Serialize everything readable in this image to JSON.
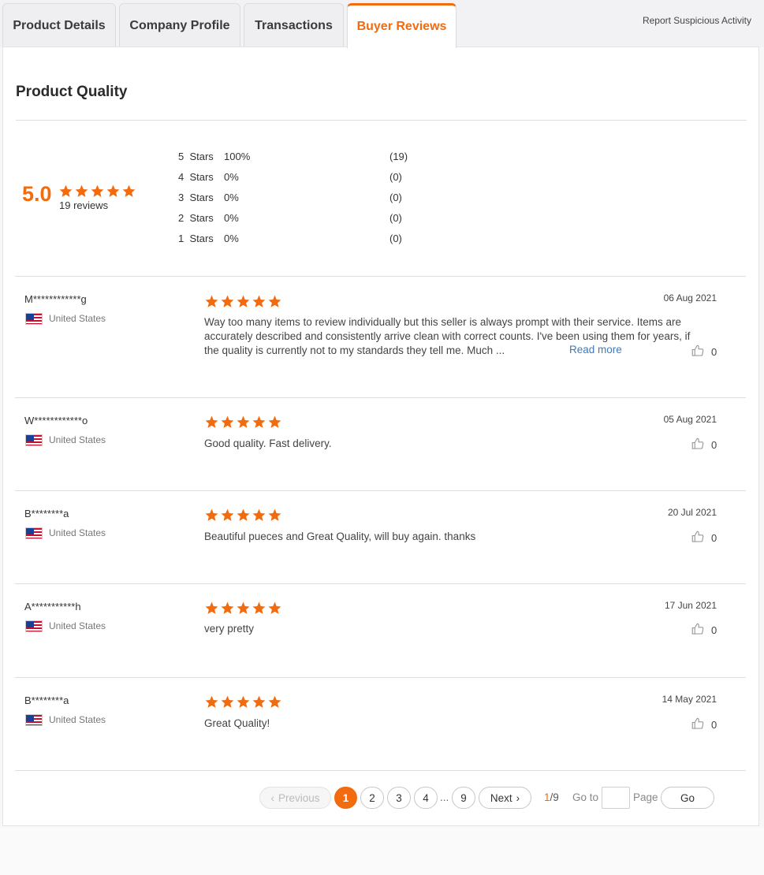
{
  "tabs": [
    {
      "label": "Product Details"
    },
    {
      "label": "Company Profile"
    },
    {
      "label": "Transactions"
    },
    {
      "label": "Buyer Reviews",
      "active": true
    }
  ],
  "report_link": "Report Suspicious Activity",
  "section_title": "Product Quality",
  "summary": {
    "score": "5.0",
    "stars": 5,
    "reviews_label": "19 reviews",
    "distribution": [
      {
        "label": "5  Stars",
        "percent": "100%",
        "count": "(19)"
      },
      {
        "label": "4  Stars",
        "percent": "0%",
        "count": "(0)"
      },
      {
        "label": "3  Stars",
        "percent": "0%",
        "count": "(0)"
      },
      {
        "label": "2  Stars",
        "percent": "0%",
        "count": "(0)"
      },
      {
        "label": "1  Stars",
        "percent": "0%",
        "count": "(0)"
      }
    ]
  },
  "reviews": [
    {
      "name": "M************g",
      "country": "United States",
      "date": "06 Aug 2021",
      "rating": 5,
      "text": "Way too many items to review individually but this seller is always prompt with their service. Items are accurately described and consistently arrive clean with correct counts. I've been using them for years, if the quality is currently not to my standards they tell me. Much ...",
      "read_more": "Read more",
      "likes": "0"
    },
    {
      "name": "W************o",
      "country": "United States",
      "date": "05 Aug 2021",
      "rating": 5,
      "text": "Good quality. Fast delivery.",
      "likes": "0"
    },
    {
      "name": "B********a",
      "country": "United States",
      "date": "20 Jul 2021",
      "rating": 5,
      "text": "Beautiful pueces and Great Quality, will buy again. thanks",
      "likes": "0"
    },
    {
      "name": "A***********h",
      "country": "United States",
      "date": "17 Jun 2021",
      "rating": 5,
      "text": "very pretty",
      "likes": "0"
    },
    {
      "name": "B********a",
      "country": "United States",
      "date": "14 May 2021",
      "rating": 5,
      "text": "Great Quality!",
      "likes": "0"
    }
  ],
  "pagination": {
    "previous": "Previous",
    "pages": [
      "1",
      "2",
      "3",
      "4"
    ],
    "ellipsis": "...",
    "last_page": "9",
    "next": "Next",
    "current_page": "1",
    "total_pages": "/9",
    "goto_label": "Go to",
    "page_label": "Page",
    "go_button": "Go"
  },
  "colors": {
    "accent": "#f26b0f",
    "link": "#3a7bbf"
  }
}
